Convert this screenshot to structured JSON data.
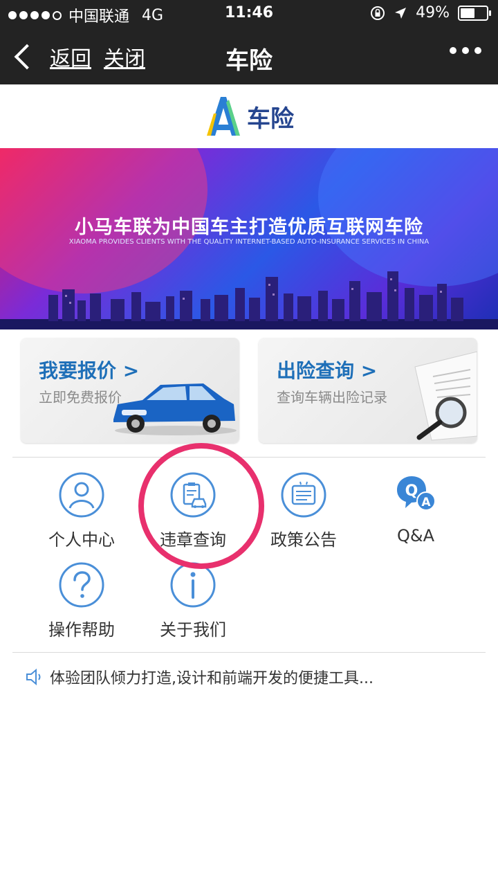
{
  "status_bar": {
    "carrier": "中国联通",
    "network": "4G",
    "time": "11:46",
    "battery": "49%",
    "battery_level": 0.49
  },
  "nav": {
    "back_label": "返回",
    "close_label": "关闭",
    "title": "车险"
  },
  "brand": {
    "logo_text": "车险"
  },
  "banner": {
    "headline": "小马车联为中国车主打造优质互联网车险",
    "subline": "XIAOMA PROVIDES CLIENTS WITH THE QUALITY INTERNET-BASED AUTO-INSURANCE SERVICES IN CHINA"
  },
  "cards": [
    {
      "title": "我要报价 >",
      "subtitle": "立即免费报价"
    },
    {
      "title": "出险查询 >",
      "subtitle": "查询车辆出险记录"
    }
  ],
  "menu": [
    {
      "label": "个人中心",
      "icon": "person-icon"
    },
    {
      "label": "违章查询",
      "icon": "violation-query-icon"
    },
    {
      "label": "政策公告",
      "icon": "policy-notice-icon"
    },
    {
      "label": "Q&A",
      "icon": "qa-icon"
    },
    {
      "label": "操作帮助",
      "icon": "help-icon"
    },
    {
      "label": "关于我们",
      "icon": "info-icon"
    }
  ],
  "notice": {
    "text": "体验团队倾力打造,设计和前端开发的便捷工具..."
  },
  "colors": {
    "accent_blue": "#1e6fb8",
    "icon_blue": "#4a8fd8",
    "annotation_pink": "#e8306d",
    "topbar": "#232323"
  }
}
